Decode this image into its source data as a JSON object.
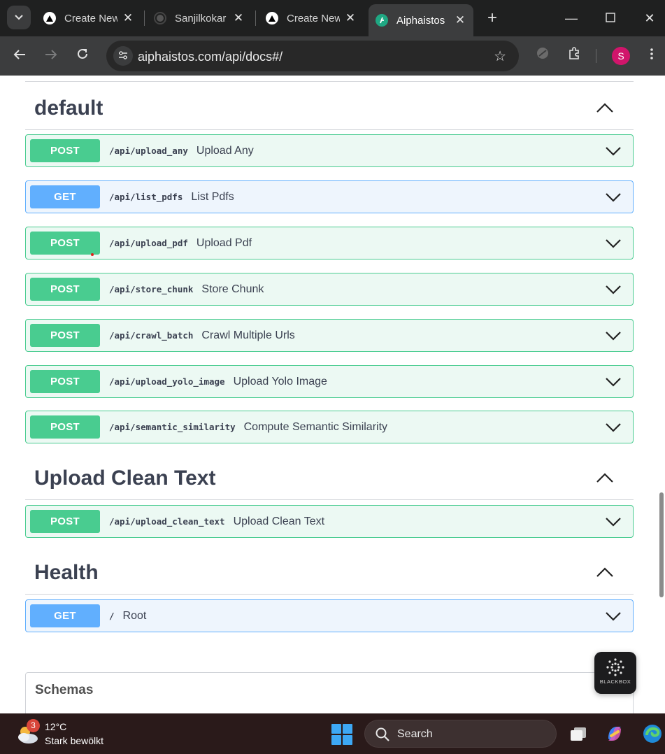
{
  "browser": {
    "tabs": [
      {
        "title": "Create New",
        "icon": "triangle-icon",
        "active": false
      },
      {
        "title": "Sanjilkokar",
        "icon": "github-icon",
        "active": false
      },
      {
        "title": "Create New",
        "icon": "triangle-icon",
        "active": false
      },
      {
        "title": "Aiphaistos",
        "icon": "swagger-icon",
        "active": true
      }
    ],
    "url": "aiphaistos.com/api/docs#/",
    "profile_initial": "S"
  },
  "sections": [
    {
      "title": "default",
      "operations": [
        {
          "method": "POST",
          "path": "/api/upload_any",
          "summary": "Upload Any"
        },
        {
          "method": "GET",
          "path": "/api/list_pdfs",
          "summary": "List Pdfs"
        },
        {
          "method": "POST",
          "path": "/api/upload_pdf",
          "summary": "Upload Pdf"
        },
        {
          "method": "POST",
          "path": "/api/store_chunk",
          "summary": "Store Chunk"
        },
        {
          "method": "POST",
          "path": "/api/crawl_batch",
          "summary": "Crawl Multiple Urls"
        },
        {
          "method": "POST",
          "path": "/api/upload_yolo_image",
          "summary": "Upload Yolo Image"
        },
        {
          "method": "POST",
          "path": "/api/semantic_similarity",
          "summary": "Compute Semantic Similarity"
        }
      ]
    },
    {
      "title": "Upload Clean Text",
      "operations": [
        {
          "method": "POST",
          "path": "/api/upload_clean_text",
          "summary": "Upload Clean Text"
        }
      ]
    },
    {
      "title": "Health",
      "operations": [
        {
          "method": "GET",
          "path": "/",
          "summary": "Root"
        }
      ]
    }
  ],
  "schemas": {
    "title": "Schemas"
  },
  "blackbox": {
    "label": "BLACKBOX"
  },
  "taskbar": {
    "weather_badge": "3",
    "temperature": "12°C",
    "condition": "Stark bewölkt",
    "search_label": "Search"
  },
  "colors": {
    "post": "#49cc90",
    "get": "#61affe"
  }
}
